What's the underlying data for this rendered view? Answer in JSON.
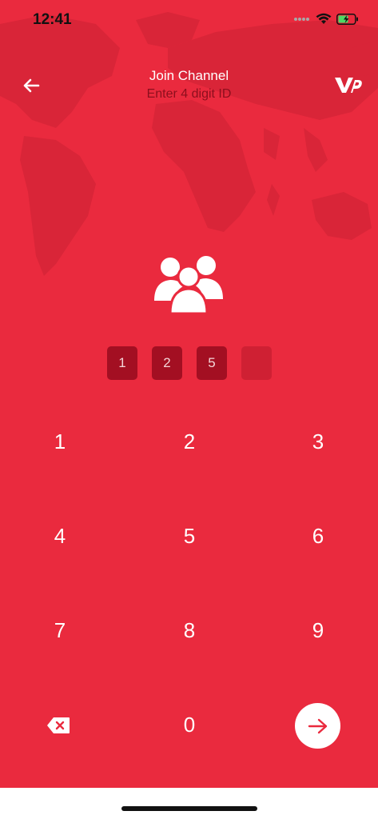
{
  "status_bar": {
    "time": "12:41",
    "icons": [
      "cellular-dots-icon",
      "wifi-icon",
      "battery-charging-icon"
    ]
  },
  "header": {
    "title": "Join Channel",
    "subtitle": "Enter 4 digit ID",
    "back_icon": "arrow-left-icon",
    "logo_text": "VP"
  },
  "pin": {
    "digits": [
      "1",
      "2",
      "5",
      ""
    ],
    "length": 4
  },
  "keypad": {
    "keys": [
      "1",
      "2",
      "3",
      "4",
      "5",
      "6",
      "7",
      "8",
      "9",
      "0"
    ],
    "delete_icon": "backspace-icon",
    "submit_icon": "arrow-right-icon"
  },
  "colors": {
    "background": "#ea2a3e",
    "pin_filled": "#a30f22",
    "pin_empty": "#cf2033",
    "subtitle": "#8c0f1d",
    "accent_white": "#ffffff"
  }
}
